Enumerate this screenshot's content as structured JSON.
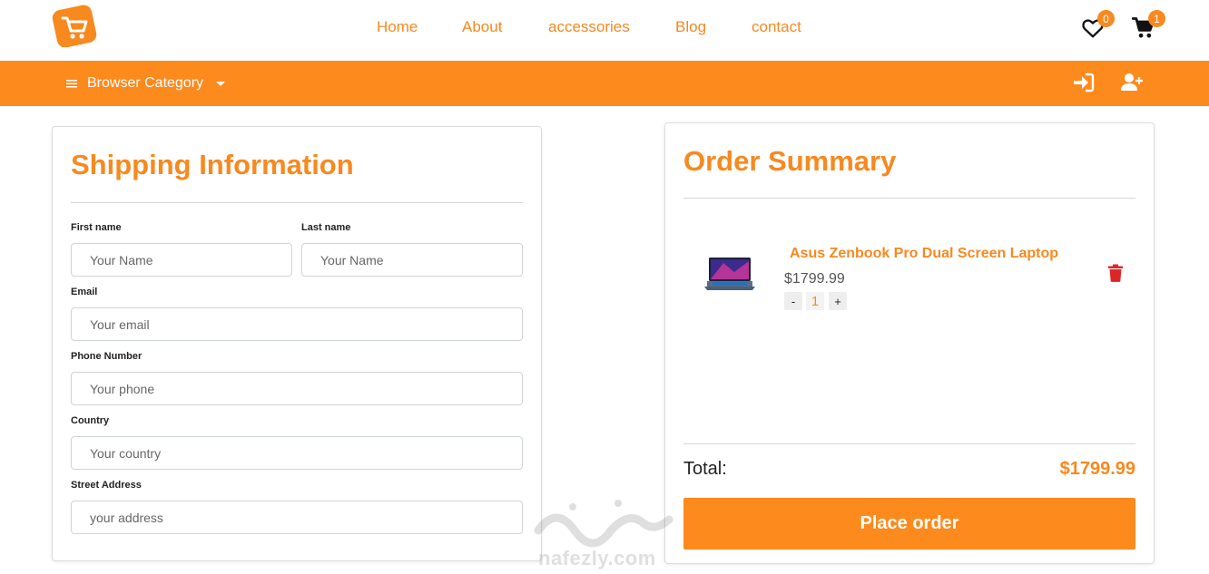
{
  "brand": {
    "logo_icon": "shopping-cart-logo",
    "accent": "#f7891f",
    "bar_color": "#fd8a1d"
  },
  "nav": {
    "items": [
      {
        "label": "Home"
      },
      {
        "label": "About"
      },
      {
        "label": "accessories"
      },
      {
        "label": "Blog"
      },
      {
        "label": "contact"
      }
    ]
  },
  "header": {
    "wishlist_count": "0",
    "cart_count": "1",
    "wishlist_icon": "heart-icon",
    "cart_icon": "cart-icon"
  },
  "category_bar": {
    "label": "Browser Category",
    "login_icon": "sign-in-icon",
    "register_icon": "user-plus-icon"
  },
  "shipping": {
    "title": "Shipping Information",
    "fields": {
      "first_name": {
        "label": "First name",
        "placeholder": "Your Name"
      },
      "last_name": {
        "label": "Last name",
        "placeholder": "Your Name"
      },
      "email": {
        "label": "Email",
        "placeholder": "Your email"
      },
      "phone": {
        "label": "Phone Number",
        "placeholder": "Your phone"
      },
      "country": {
        "label": "Country",
        "placeholder": "Your country"
      },
      "address": {
        "label": "Street Address",
        "placeholder": "your address"
      }
    }
  },
  "order": {
    "title": "Order Summary",
    "item": {
      "name": "Asus Zenbook Pro Dual Screen Laptop",
      "price": "$1799.99",
      "qty": "1",
      "minus": "-",
      "plus": "+"
    },
    "total_label": "Total:",
    "total_value": "$1799.99",
    "place_order": "Place order"
  },
  "watermark": {
    "text": "nafezly.com"
  }
}
